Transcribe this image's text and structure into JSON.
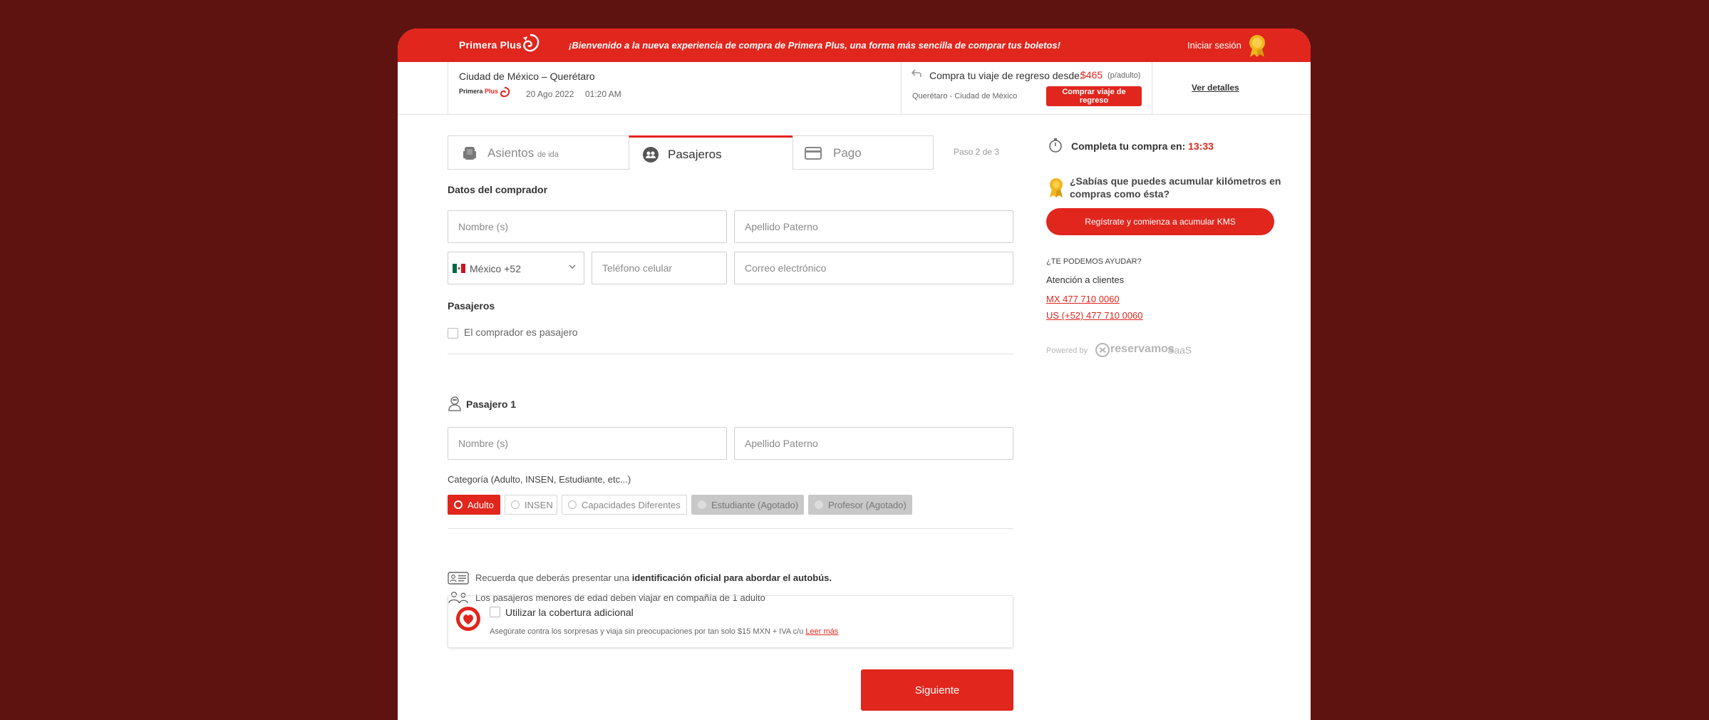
{
  "header": {
    "brand_primary": "Primera",
    "brand_secondary": "Plus",
    "welcome": "¡Bienvenido a la nueva experiencia de compra de Primera Plus, una forma más sencilla de comprar tus boletos!",
    "login": "Iniciar sesión"
  },
  "trip": {
    "route": "Ciudad de México – Querétaro",
    "carrier_primary": "Primera",
    "carrier_secondary": "Plus",
    "date": "20 Ago 2022",
    "time": "01:20 AM",
    "return_prompt": "Compra tu viaje de regreso desde:",
    "return_price": "$465",
    "return_unit": "(p/adulto)",
    "return_route": "Querétaro - Ciudad de México",
    "return_button": "Comprar viaje de regreso",
    "details_link": "Ver detalles"
  },
  "tabs": {
    "asientos": "Asientos",
    "asientos_sub": "de ida",
    "pasajeros": "Pasajeros",
    "pago": "Pago",
    "step": "Paso 2 de 3"
  },
  "buyer": {
    "title": "Datos del comprador",
    "name_placeholder": "Nombre (s)",
    "lastname_placeholder": "Apellido Paterno",
    "country": "México +52",
    "phone_placeholder": "Teléfono celular",
    "email_placeholder": "Correo electrónico"
  },
  "passengers": {
    "title": "Pasajeros",
    "buyer_is_passenger": "El comprador es pasajero",
    "passenger_title": "Pasajero 1",
    "name_placeholder": "Nombre (s)",
    "lastname_placeholder": "Apellido Paterno",
    "category_label": "Categoría (Adulto, INSEN, Estudiante, etc...)",
    "categories": [
      {
        "label": "Adulto",
        "state": "active"
      },
      {
        "label": "INSEN",
        "state": "normal"
      },
      {
        "label": "Capacidades Diferentes",
        "state": "normal"
      },
      {
        "label": "Estudiante (Agotado)",
        "state": "disabled"
      },
      {
        "label": "Profesor (Agotado)",
        "state": "disabled"
      }
    ]
  },
  "notes": {
    "id_prefix": "Recuerda que deberás presentar una",
    "id_bold": "identificación oficial para abordar el autobús.",
    "minors": "Los pasajeros menores de edad deben viajar en compañía de 1 adulto"
  },
  "coverage": {
    "title": "Utilizar la cobertura adicional",
    "desc": "Asegúrate contra los sorpresas y viaja sin preocupaciones por tan solo $15 MXN + IVA c/u",
    "link": "Leer más"
  },
  "actions": {
    "next": "Siguiente"
  },
  "sidebar": {
    "timer_label": "Completa tu compra en:",
    "timer_value": "13:33",
    "km_text": "¿Sabías que puedes acumular kilómetros en compras como ésta?",
    "register_button": "Regístrate y comienza a acumular KMS",
    "help_title": "¿TE PODEMOS AYUDAR?",
    "help_sub": "Atención a clientes",
    "phone_mx": "MX 477 710 0060",
    "phone_us": "US (+52) 477 710 0060",
    "powered": "Powered by",
    "powered_brand": "reservamos",
    "powered_suffix": "SaaS"
  },
  "colors": {
    "brand_red": "#e0261d",
    "background": "#5e1310"
  }
}
